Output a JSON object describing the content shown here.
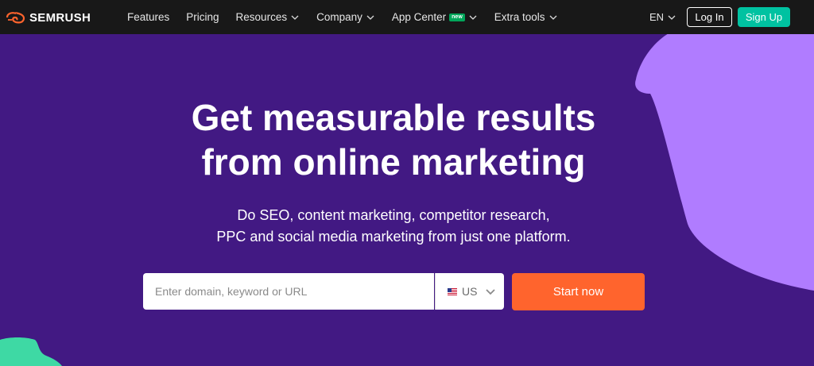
{
  "brand": {
    "name": "SEMRUSH"
  },
  "nav": {
    "items": [
      {
        "label": "Features",
        "dropdown": false
      },
      {
        "label": "Pricing",
        "dropdown": false
      },
      {
        "label": "Resources",
        "dropdown": true
      },
      {
        "label": "Company",
        "dropdown": true
      },
      {
        "label": "App Center",
        "dropdown": true,
        "badge": "new"
      },
      {
        "label": "Extra tools",
        "dropdown": true
      }
    ],
    "language": "EN",
    "login_label": "Log In",
    "signup_label": "Sign Up"
  },
  "hero": {
    "title_line1": "Get measurable results",
    "title_line2": "from online marketing",
    "subtitle_line1": "Do SEO, content marketing, competitor research,",
    "subtitle_line2": "PPC and social media marketing from just one platform."
  },
  "search": {
    "placeholder": "Enter domain, keyword or URL",
    "value": "",
    "country": "US",
    "submit_label": "Start now"
  },
  "colors": {
    "background": "#421983",
    "header": "#181818",
    "accent_orange": "#ff642d",
    "accent_teal": "#00c2a1",
    "shape_lilac": "#b07cff",
    "shape_green": "#3ed9a4"
  },
  "icons": [
    "semrush-logo-icon",
    "chevron-down-icon",
    "us-flag-icon"
  ]
}
